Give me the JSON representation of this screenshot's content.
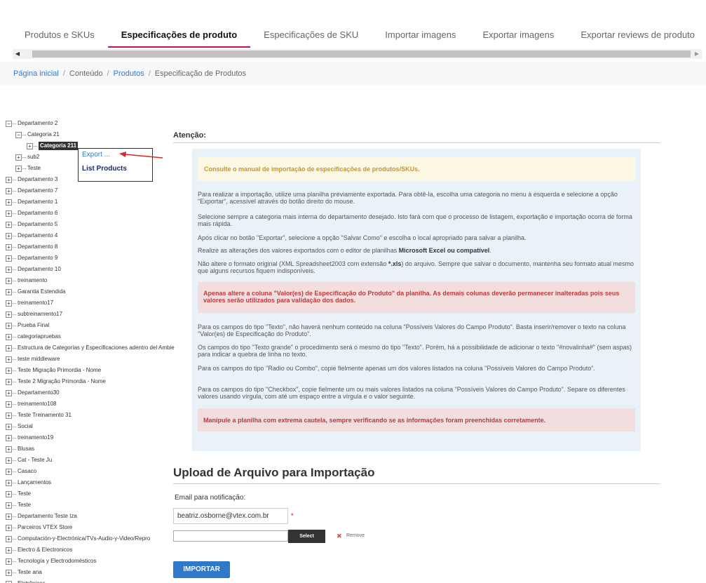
{
  "tabs": [
    "Produtos e SKUs",
    "Especificações de produto",
    "Especificações de SKU",
    "Importar imagens",
    "Exportar imagens",
    "Exportar reviews de produto"
  ],
  "active_tab": "Especificações de produto",
  "breadcrumb": {
    "home": "Página inicial",
    "content": "Conteúdo",
    "products": "Produtos",
    "current": "Especificação de Produtos"
  },
  "tree": {
    "dept2": "Departamento 2",
    "cat21": "Categoria 21",
    "cat211": "Categoria 211",
    "sub2": "sub2",
    "teste": "Teste",
    "items": [
      "Departamento 3",
      "Departamento 7",
      "Departamento 1",
      "Departamento 6",
      "Departamento 5",
      "Departamento 4",
      "Departamento 8",
      "Departamento 9",
      "Departamento 10",
      "treinamento",
      "Garantia Estendida",
      "treinamento17",
      "subtreinamento17",
      "Prueba Final",
      "categoriapruebas",
      "Estructura de Categorías y Especificaciones adentro del Ambie",
      "teste middleware",
      "Teste Migração Primordia - Nome",
      "Teste 2 Migração Primordia - Nome",
      "Departamento30",
      "treinamento108",
      "Teste Treinamento 31",
      "Social",
      "treinamento19",
      "Blusas",
      "Cat - Teste Ju",
      "Casaco",
      "Lançamentos",
      "Teste",
      "Teste",
      "Departamento Teste Iza",
      "Parceiros VTEX Store",
      "Computación-y-Electrónica/TVs-Audio-y-Video/Repro",
      "Electro & Electronicos",
      "Tecnología y Electrodomésticos",
      "Teste ana",
      "Eletrônicos"
    ]
  },
  "context_menu": {
    "export": "Export ...",
    "list_products": "List Products"
  },
  "attention_title": "Atenção:",
  "manual_notice": "Consulte o manual de importação de especificações de produtos/SKUs.",
  "instructions": {
    "p1": "Para realizar a importação, utilize uma planilha previamente exportada. Para obtê-la, escolha uma categoria no menu à esquerda e selecione a opção \"Exportar\", acessível através do botão direito do mouse.",
    "p2": "Selecione sempre a categoria mais interna do departamento desejado. Isto fará com que o processo de listagem, exportação e importação ocorra de forma mais rápida.",
    "p3": "Após clicar no botão \"Exportar\", selecione a opção \"Salvar Como\" e escolha o local apropriado para salvar a planilha.",
    "p4_a": "Realize as alterações dos valores exportados com o editor de planilhas ",
    "p4_b": "Microsoft Excel ou compatível",
    "p4_c": ".",
    "p5_a": "Não altere o formato original (XML Spreadsheet2003 com extensão ",
    "p5_b": "*.xls",
    "p5_c": ") do arquivo. Sempre que salvar o documento, mantenha seu formato atual mesmo que alguns recursos fiquem indisponíveis.",
    "danger1": "Apenas altere a coluna \"Valor(es) de Especificação do Produto\" da planilha. As demais colunas deverão permanecer inalteradas pois seus valores serão utilizados para validação dos dados.",
    "p6": "Para os campos do tipo \"Texto\", não haverá nenhum conteúdo na coluna \"Possíveis Valores do Campo Produto\". Basta inserir/remover o texto na coluna \"Valor(es) de Especificação do Produto\".",
    "p7": "Os campos do tipo \"Texto grande\" o procedimento será o mesmo do tipo \"Texto\". Porém, há a possibilidade de adicionar o texto \"#novalinha#\" (sem aspas) para indicar a quebra de linha no texto.",
    "p8": "Para os campos do tipo \"Radio ou Combo\", copie fielmente apenas um dos valores listados na coluna \"Possíveis Valores do Campo Produto\".",
    "p9": "Para os campos do tipo \"Checkbox\", copie fielmente um ou mais valores listados na coluna \"Possíveis Valores do Campo Produto\". Separe os diferentes valores usando vírgula, com até um espaço entre a vírgula e o valor seguinte.",
    "danger2": "Manipule a planilha com extrema cautela, sempre verificando se as informações foram preenchidas corretamente."
  },
  "upload": {
    "title": "Upload de Arquivo para Importação",
    "email_label": "Email para notificação:",
    "email_value": "beatriz.osborne@vtex.com.br",
    "required_mark": "*",
    "select_label": "Select",
    "remove_label": "Remove",
    "import_label": "IMPORTAR"
  },
  "colors": {
    "accent_tab": "#c8134c",
    "link": "#2f79c8",
    "panel_bg": "#eaf2f9",
    "warning_text": "#c7962a",
    "danger_text": "#c0383e"
  }
}
